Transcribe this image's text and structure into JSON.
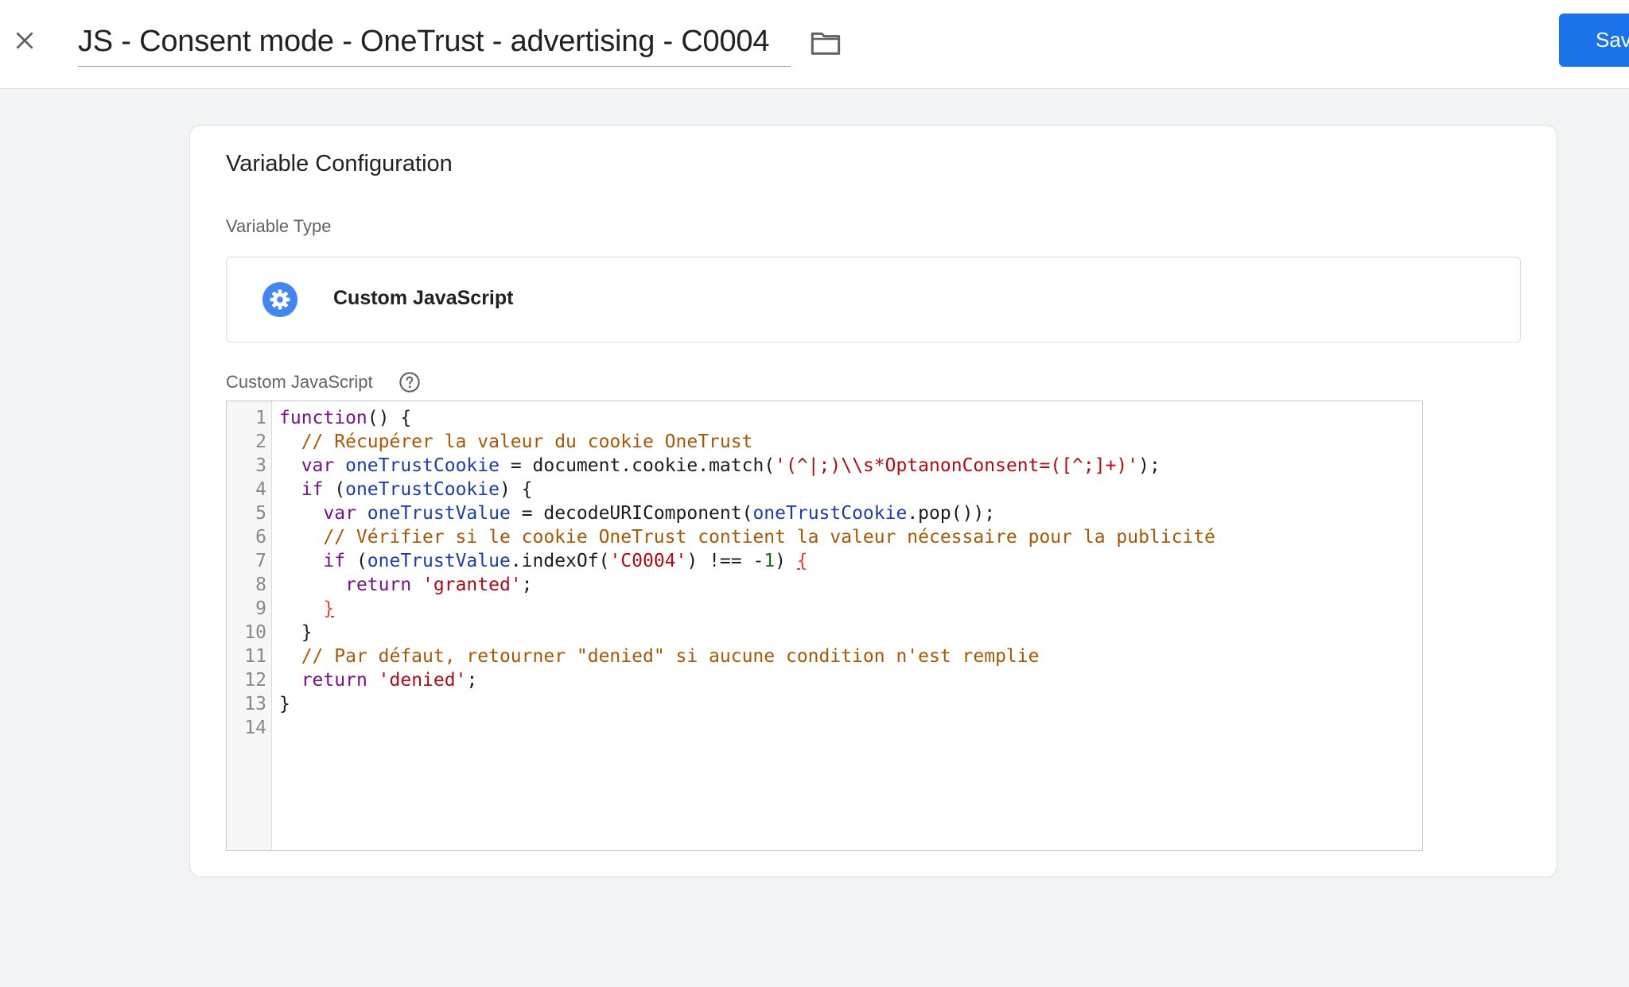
{
  "header": {
    "title": "JS - Consent mode - OneTrust - advertising - C0004",
    "save_label": "Save"
  },
  "card": {
    "title": "Variable Configuration",
    "variable_type_label": "Variable Type",
    "variable_type_name": "Custom JavaScript",
    "code_label": "Custom JavaScript"
  },
  "icons": {
    "close": "close-icon",
    "folder": "folder-icon",
    "type": "gear-icon",
    "help": "help-circle-icon"
  },
  "colors": {
    "accent": "#1a73e8",
    "background": "#f1f3f4"
  },
  "editor": {
    "line_numbers": [
      "1",
      "2",
      "3",
      "4",
      "5",
      "6",
      "7",
      "8",
      "9",
      "10",
      "11",
      "12",
      "13",
      "14"
    ],
    "lines": [
      [
        {
          "t": "function",
          "c": "kw"
        },
        {
          "t": "() {",
          "c": ""
        }
      ],
      [
        {
          "t": "  ",
          "c": ""
        },
        {
          "t": "// Récupérer la valeur du cookie OneTrust",
          "c": "cmt"
        }
      ],
      [
        {
          "t": "  ",
          "c": ""
        },
        {
          "t": "var",
          "c": "kw"
        },
        {
          "t": " ",
          "c": ""
        },
        {
          "t": "oneTrustCookie",
          "c": "def"
        },
        {
          "t": " = document.cookie.match(",
          "c": ""
        },
        {
          "t": "'(^|;)\\\\s*OptanonConsent=([^;]+)'",
          "c": "str"
        },
        {
          "t": ");",
          "c": ""
        }
      ],
      [
        {
          "t": "  ",
          "c": ""
        },
        {
          "t": "if",
          "c": "kw"
        },
        {
          "t": " (",
          "c": ""
        },
        {
          "t": "oneTrustCookie",
          "c": "def"
        },
        {
          "t": ") {",
          "c": ""
        }
      ],
      [
        {
          "t": "    ",
          "c": ""
        },
        {
          "t": "var",
          "c": "kw"
        },
        {
          "t": " ",
          "c": ""
        },
        {
          "t": "oneTrustValue",
          "c": "def"
        },
        {
          "t": " = decodeURIComponent(",
          "c": ""
        },
        {
          "t": "oneTrustCookie",
          "c": "def"
        },
        {
          "t": ".pop());",
          "c": ""
        }
      ],
      [
        {
          "t": "    ",
          "c": ""
        },
        {
          "t": "// Vérifier si le cookie OneTrust contient la valeur nécessaire pour la publicité",
          "c": "cmt"
        }
      ],
      [
        {
          "t": "    ",
          "c": ""
        },
        {
          "t": "if",
          "c": "kw"
        },
        {
          "t": " (",
          "c": ""
        },
        {
          "t": "oneTrustValue",
          "c": "def"
        },
        {
          "t": ".indexOf(",
          "c": ""
        },
        {
          "t": "'C0004'",
          "c": "str"
        },
        {
          "t": ") !== -",
          "c": ""
        },
        {
          "t": "1",
          "c": "num"
        },
        {
          "t": ") ",
          "c": ""
        },
        {
          "t": "{",
          "c": "bad"
        }
      ],
      [
        {
          "t": "      ",
          "c": ""
        },
        {
          "t": "return",
          "c": "kw"
        },
        {
          "t": " ",
          "c": ""
        },
        {
          "t": "'granted'",
          "c": "str"
        },
        {
          "t": ";",
          "c": ""
        }
      ],
      [
        {
          "t": "    ",
          "c": ""
        },
        {
          "t": "}",
          "c": "bad"
        }
      ],
      [
        {
          "t": "  }",
          "c": ""
        }
      ],
      [
        {
          "t": "  ",
          "c": ""
        },
        {
          "t": "// Par défaut, retourner \"denied\" si aucune condition n'est remplie",
          "c": "cmt"
        }
      ],
      [
        {
          "t": "  ",
          "c": ""
        },
        {
          "t": "return",
          "c": "kw"
        },
        {
          "t": " ",
          "c": ""
        },
        {
          "t": "'denied'",
          "c": "str"
        },
        {
          "t": ";",
          "c": ""
        }
      ],
      [
        {
          "t": "}",
          "c": ""
        }
      ],
      []
    ]
  }
}
